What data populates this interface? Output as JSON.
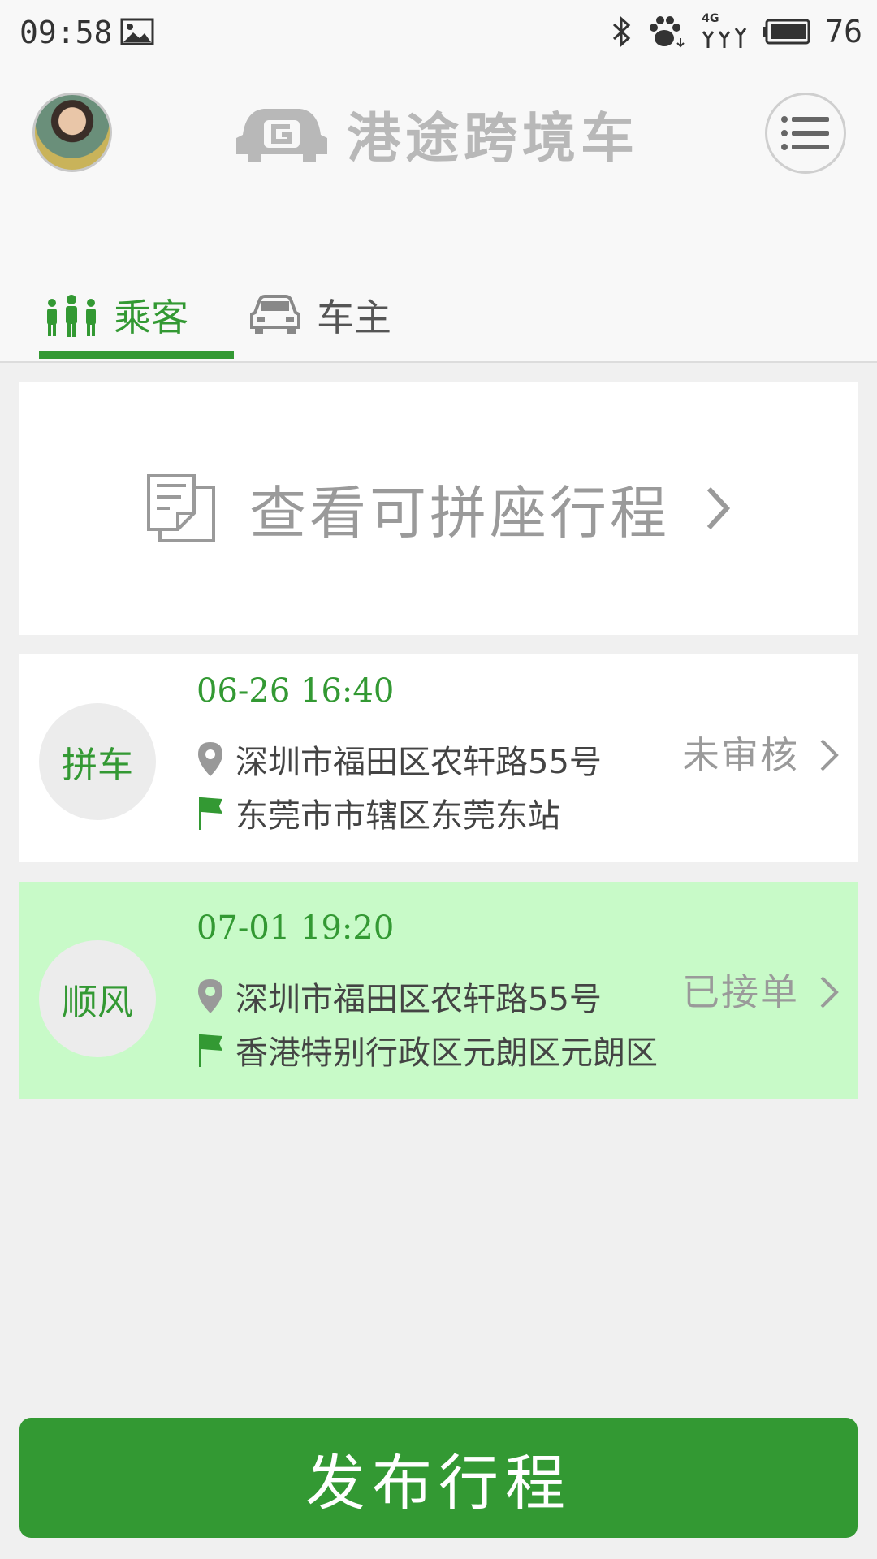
{
  "status_bar": {
    "time": "09:58",
    "network": "4G",
    "battery_level": "76"
  },
  "header": {
    "logo_text": "港途跨境车",
    "tabs": [
      {
        "label": "乘客",
        "active": true
      },
      {
        "label": "车主",
        "active": false
      }
    ]
  },
  "view_card": {
    "label": "查看可拼座行程"
  },
  "trips": [
    {
      "type": "拼车",
      "time": "06-26 16:40",
      "from": "深圳市福田区农轩路55号",
      "to": "东莞市市辖区东莞东站",
      "status": "未审核",
      "highlight": false
    },
    {
      "type": "顺风",
      "time": "07-01 19:20",
      "from": "深圳市福田区农轩路55号",
      "to": "香港特别行政区元朗区元朗区",
      "status": "已接单",
      "highlight": true
    }
  ],
  "publish_button": {
    "label": "发布行程"
  },
  "colors": {
    "accent": "#339933",
    "highlight_row": "#c8fac8",
    "muted_text": "#9a9a9a"
  }
}
